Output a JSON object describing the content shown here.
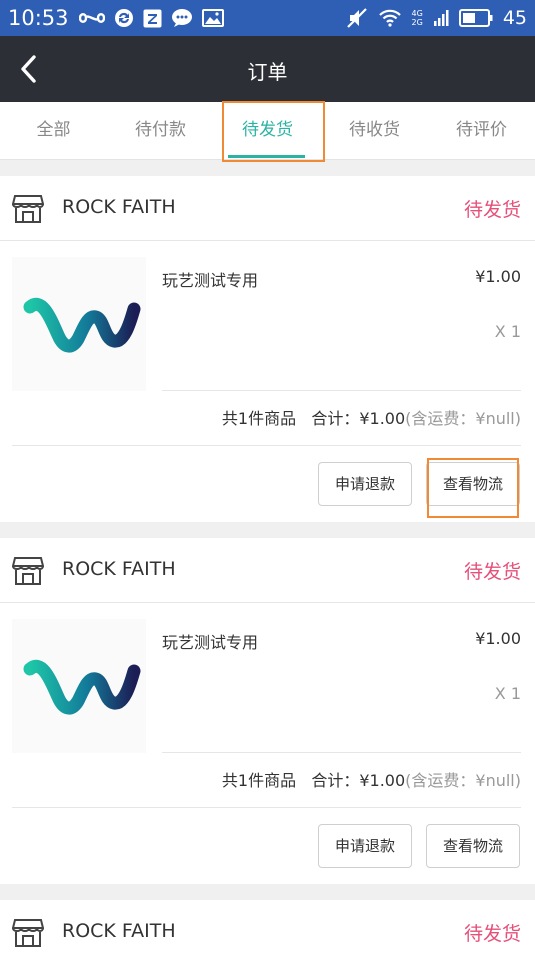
{
  "status_bar": {
    "time": "10:53",
    "battery": "45",
    "left_icons": [
      "infinity-icon",
      "sync-icon",
      "z-app-icon",
      "wechat-icon",
      "gallery-icon"
    ],
    "right_icons": [
      "mute-icon",
      "wifi-icon",
      "signal-icon",
      "battery-icon"
    ],
    "network_4g": "4G",
    "network_2g": "2G",
    "color": "#2f5fb5"
  },
  "navbar": {
    "title": "订单",
    "back_icon": "chevron-left-icon",
    "color": "#2d2f36"
  },
  "tabs": [
    {
      "label": "全部",
      "active": false
    },
    {
      "label": "待付款",
      "active": false
    },
    {
      "label": "待发货",
      "active": true
    },
    {
      "label": "待收货",
      "active": false
    },
    {
      "label": "待评价",
      "active": false
    }
  ],
  "orders": [
    {
      "store_name": "ROCK FAITH",
      "status": "待发货",
      "goods_name": "玩艺测试专用",
      "price": "¥1.00",
      "quantity": "X 1",
      "count_text": "共1件商品",
      "total_text": "合计：¥1.00",
      "shipping_text": "(含运费：¥null)",
      "refund_label": "申请退款",
      "logistics_label": "查看物流"
    },
    {
      "store_name": "ROCK FAITH",
      "status": "待发货",
      "goods_name": "玩艺测试专用",
      "price": "¥1.00",
      "quantity": "X 1",
      "count_text": "共1件商品",
      "total_text": "合计：¥1.00",
      "shipping_text": "(含运费：¥null)",
      "refund_label": "申请退款",
      "logistics_label": "查看物流"
    },
    {
      "store_name": "ROCK FAITH",
      "status": "待发货"
    }
  ],
  "colors": {
    "accent_tab": "#2ab3a3",
    "status_pink": "#e5507a",
    "highlight_box": "#f08a35"
  }
}
